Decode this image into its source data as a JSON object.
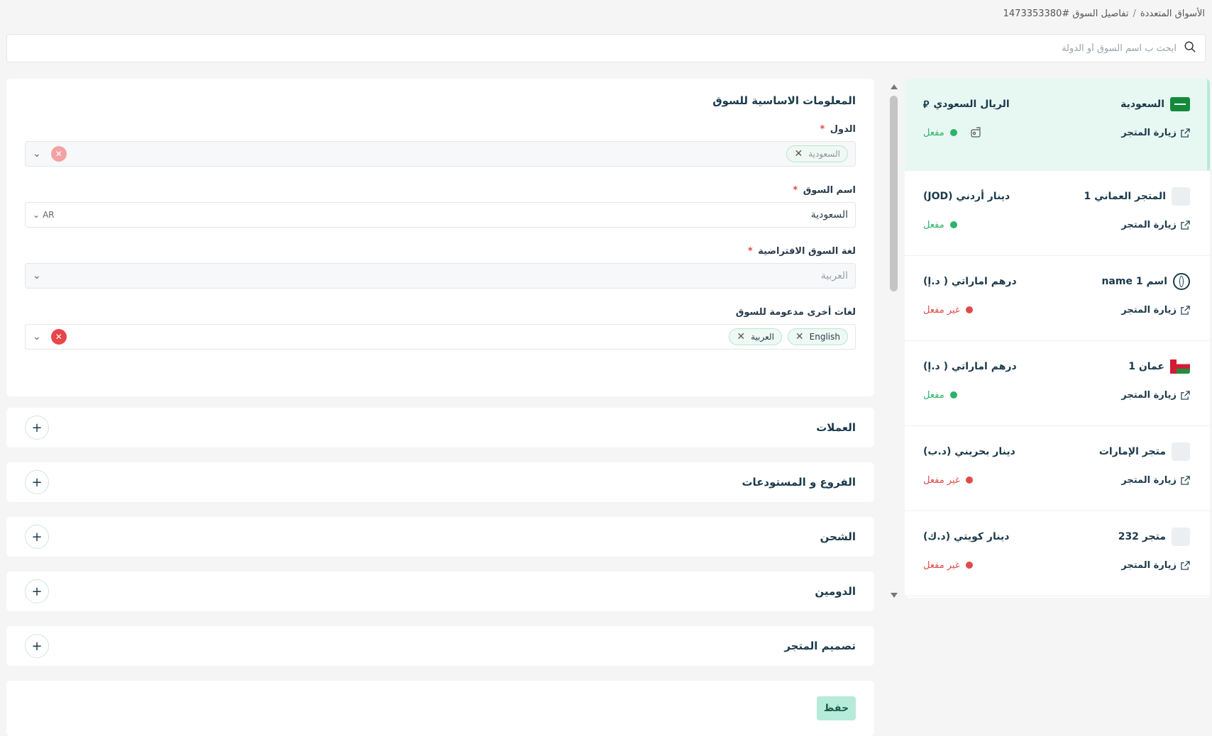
{
  "breadcrumb": {
    "parent": "الأسواق المتعددة",
    "separator": "/",
    "current": "تفاصيل السوق #1473353380"
  },
  "search": {
    "placeholder": "ابحث ب اسم السوق أو الدولة"
  },
  "basic_info": {
    "title": "المعلومات الاساسية للسوق",
    "countries": {
      "label": "الدول",
      "required": "*",
      "tags": [
        "السعودية"
      ]
    },
    "market_name": {
      "label": "اسم السوق",
      "required": "*",
      "value": "السعودية",
      "lang": "AR"
    },
    "default_language": {
      "label": "لغة السوق الافتراضية",
      "required": "*",
      "value": "العربية"
    },
    "other_languages": {
      "label": "لغات أخرى مدعومة للسوق",
      "tags": [
        "English",
        "العربية"
      ]
    }
  },
  "sections": [
    {
      "title": "العملات"
    },
    {
      "title": "الفروع و المستودعات"
    },
    {
      "title": "الشحن"
    },
    {
      "title": "الدومين"
    },
    {
      "title": "تصميم المتجر"
    }
  ],
  "save_label": "حفظ",
  "visit_label": "زيارة المتجر",
  "markets": [
    {
      "name": "السعودية",
      "currency": "الريال السعودي",
      "currency_symbol": "⃁",
      "status": "مفعل",
      "enabled": true,
      "flag": "sa"
    },
    {
      "name": "المتجر العماني 1",
      "currency": "دينار أردني (JOD)",
      "status": "مفعل",
      "enabled": true,
      "flag": "none"
    },
    {
      "name": "اسم 1 name",
      "currency": "درهم اماراتي ( د.إ)",
      "status": "غير مفعل",
      "enabled": false,
      "flag": "globe"
    },
    {
      "name": "عمان 1",
      "currency": "درهم اماراتي ( د.إ)",
      "status": "مفعل",
      "enabled": true,
      "flag": "om"
    },
    {
      "name": "متجر الإمارات",
      "currency": "دينار بحريني (د.ب)",
      "status": "غير مفعل",
      "enabled": false,
      "flag": "none"
    },
    {
      "name": "متجر 232",
      "currency": "دينار كويتي (د.ك)",
      "status": "غير مفعل",
      "enabled": false,
      "flag": "none"
    }
  ]
}
